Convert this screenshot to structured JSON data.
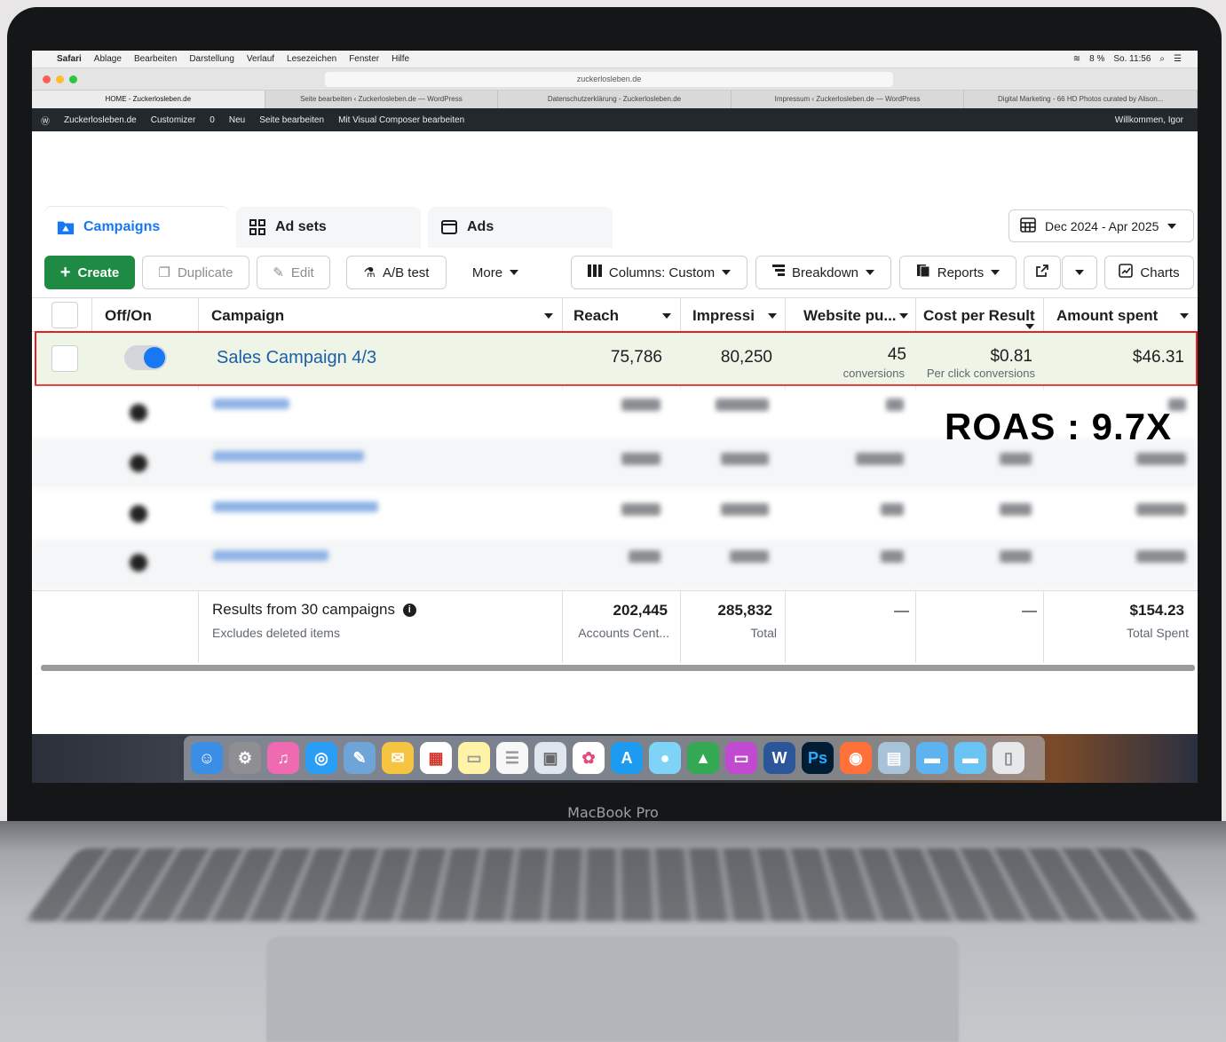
{
  "mac_menubar": {
    "items": [
      "Safari",
      "Ablage",
      "Bearbeiten",
      "Darstellung",
      "Verlauf",
      "Lesezeichen",
      "Fenster",
      "Hilfe"
    ],
    "battery": "8 %",
    "clock": "So. 11:56"
  },
  "browser": {
    "url": "zuckerlosleben.de",
    "tabs": [
      "HOME - Zuckerlosleben.de",
      "Seite bearbeiten ‹ Zuckerlosleben.de — WordPress",
      "Datenschutzerklärung - Zuckerlosleben.de",
      "Impressum ‹ Zuckerlosleben.de — WordPress",
      "Digital Marketing - 66 HD Photos curated by Alison..."
    ]
  },
  "wp_adminbar": {
    "site": "Zuckerlosleben.de",
    "customizer": "Customizer",
    "comments": "0",
    "new": "Neu",
    "edit_page": "Seite bearbeiten",
    "vc": "Mit Visual Composer bearbeiten",
    "welcome": "Willkommen, Igor"
  },
  "tabs": {
    "campaigns": "Campaigns",
    "adsets": "Ad sets",
    "ads": "Ads"
  },
  "date_range": "Dec 2024 - Apr 2025",
  "toolbar": {
    "create": "Create",
    "duplicate": "Duplicate",
    "edit": "Edit",
    "ab_test": "A/B test",
    "more": "More",
    "columns": "Columns: Custom",
    "breakdown": "Breakdown",
    "reports": "Reports",
    "charts": "Charts"
  },
  "table": {
    "headers": {
      "offon": "Off/On",
      "campaign": "Campaign",
      "reach": "Reach",
      "impressions": "Impressi",
      "website": "Website pu...",
      "cpr": "Cost per Result",
      "spent": "Amount spent"
    },
    "highlight_row": {
      "name": "Sales Campaign 4/3",
      "reach": "75,786",
      "impressions": "80,250",
      "website": "45",
      "website_sub": "conversions",
      "cpr": "$0.81",
      "cpr_sub": "Per click conversions",
      "spent": "$46.31"
    },
    "summary": {
      "label": "Results from 30 campaigns",
      "sub": "Excludes deleted items",
      "reach": "202,445",
      "reach_sub": "Accounts Cent...",
      "impressions": "285,832",
      "impressions_sub": "Total",
      "website": "—",
      "cpr": "—",
      "spent": "$154.23",
      "spent_sub": "Total Spent"
    }
  },
  "overlay": {
    "roas": "ROAS : 9.7X"
  },
  "laptop": {
    "label": "MacBook Pro"
  },
  "colors": {
    "accent": "#1877f2",
    "create": "#1e8a44",
    "highlight_border": "#e5201f",
    "highlight_bg": "#eef5e6"
  }
}
